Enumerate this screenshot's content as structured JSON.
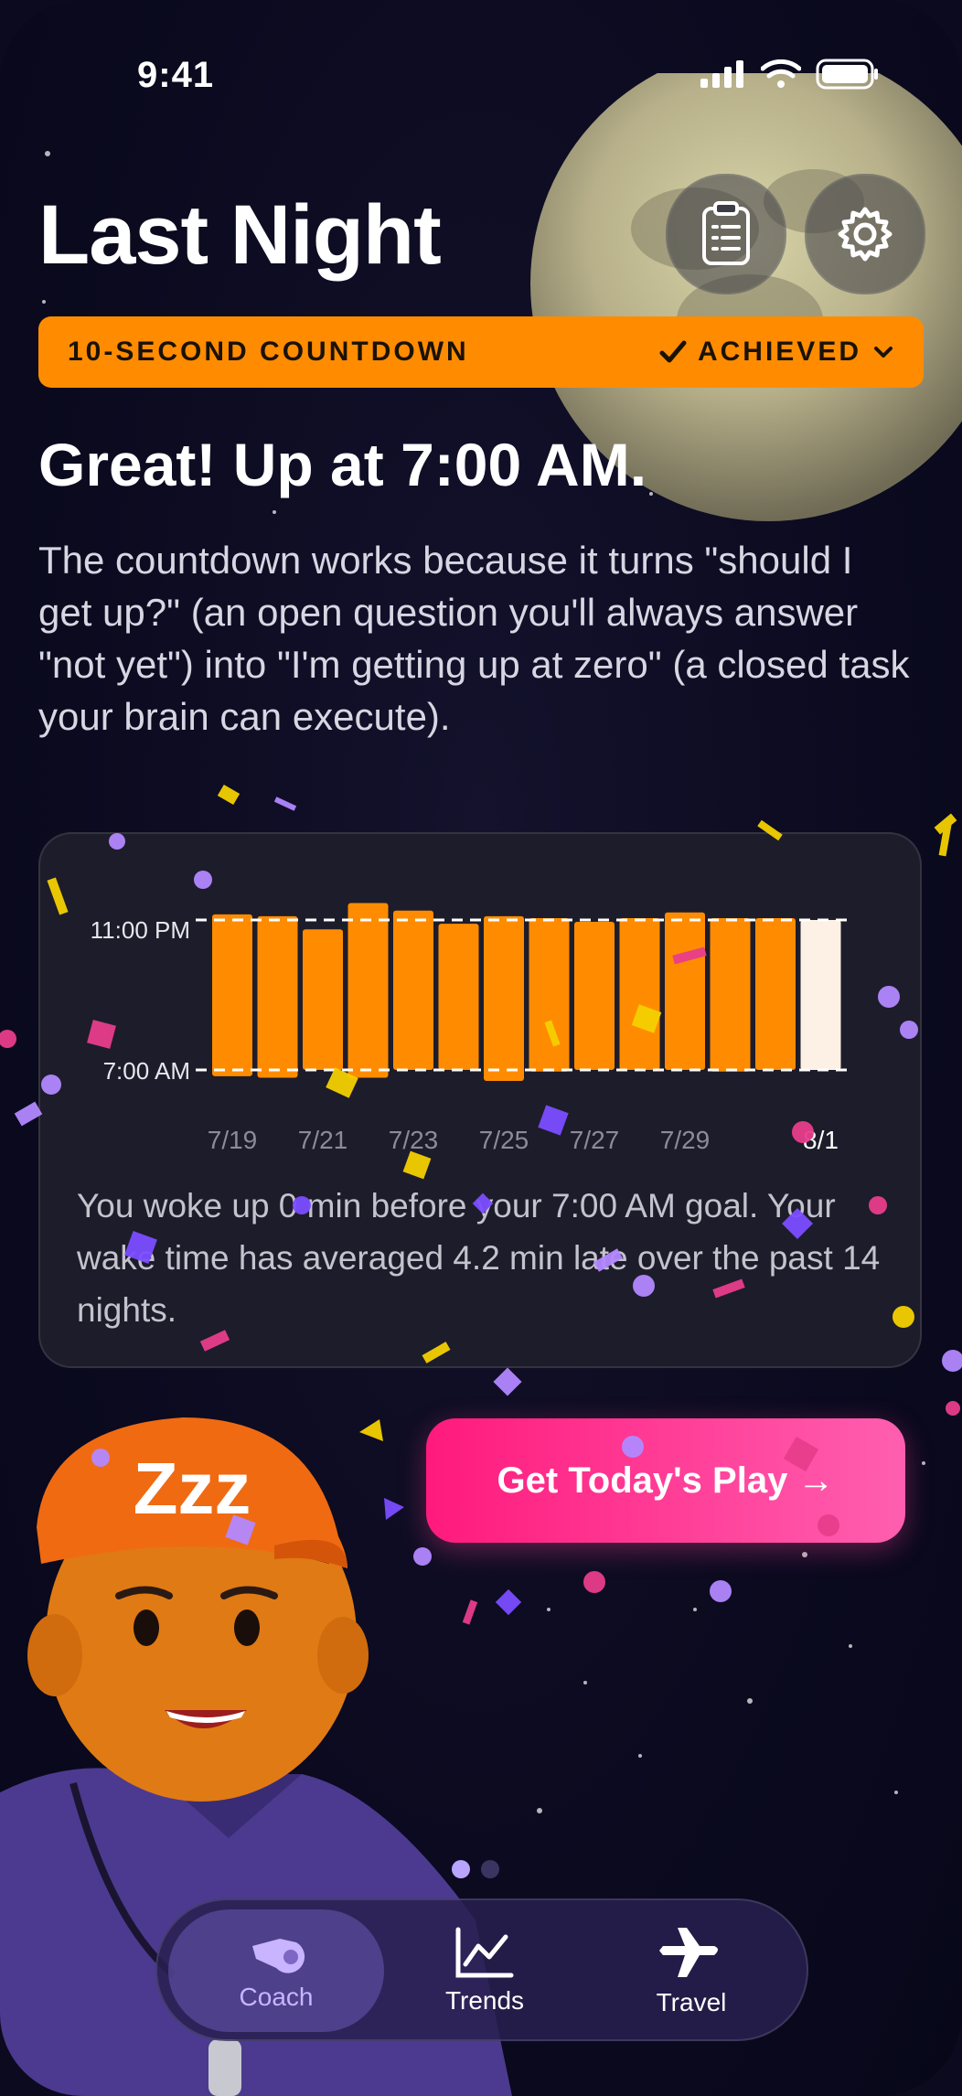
{
  "status_bar": {
    "time": "9:41"
  },
  "header": {
    "title": "Last Night"
  },
  "banner": {
    "label": "10-SECOND COUNTDOWN",
    "status": "ACHIEVED"
  },
  "headline": "Great! Up at 7:00 AM.",
  "body": "The countdown works because it turns \"should I get up?\" (an open question you'll always answer \"not yet\") into \"I'm getting up at zero\" (a closed task your brain can execute).",
  "chart_data": {
    "type": "bar",
    "y_top_label": "11:00 PM",
    "y_bottom_label": "7:00 AM",
    "x_tick_labels": [
      "7/19",
      "7/21",
      "7/23",
      "7/25",
      "7/27",
      "7/29",
      "8/1"
    ],
    "categories": [
      "7/19",
      "7/20",
      "7/21",
      "7/22",
      "7/23",
      "7/24",
      "7/25",
      "7/26",
      "7/27",
      "7/28",
      "7/29",
      "7/30",
      "7/31",
      "8/1"
    ],
    "bed_offset_hours": [
      -0.3,
      -0.2,
      0.5,
      -0.9,
      -0.5,
      0.2,
      -0.2,
      -0.1,
      0.1,
      -0.1,
      -0.4,
      -0.1,
      -0.1,
      0.0
    ],
    "wake_offset_minutes": [
      20,
      25,
      0,
      25,
      0,
      0,
      35,
      5,
      0,
      0,
      0,
      5,
      0,
      0
    ],
    "colors": {
      "bar": "#ff8c00",
      "today_bar": "#fdf0e4",
      "goal_line": "#ffffff"
    }
  },
  "card_note": "You woke up 0 min before your 7:00 AM goal. Your wake time has averaged 4.2 min late over the past 14 nights.",
  "cta": {
    "label": "Get Today's Play →"
  },
  "mascot": {
    "cap_text": "Zzz"
  },
  "tabs": [
    {
      "label": "Coach",
      "icon": "whistle-icon",
      "active": true
    },
    {
      "label": "Trends",
      "icon": "trend-chart-icon",
      "active": false
    },
    {
      "label": "Travel",
      "icon": "airplane-icon",
      "active": false
    }
  ],
  "colors": {
    "accent": "#ff8c00",
    "cta": "#ff1a7d",
    "background": "#0b0a1f"
  }
}
